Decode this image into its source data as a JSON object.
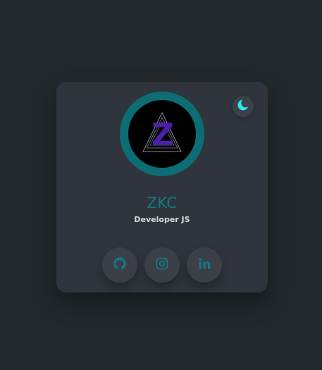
{
  "profile": {
    "name": "ZKC",
    "role": "Developer JS",
    "logo_letter": "Z"
  },
  "theme_toggle": {
    "icon": "moon-icon",
    "state": "dark"
  },
  "social": [
    {
      "icon": "github-icon"
    },
    {
      "icon": "instagram-icon"
    },
    {
      "icon": "linkedin-icon"
    }
  ],
  "colors": {
    "background": "#23282c",
    "card": "#30353d",
    "accent": "#137a84",
    "ring": "#0c6d74",
    "moon": "#2ee6f0",
    "logo": "#4b1fa8"
  }
}
